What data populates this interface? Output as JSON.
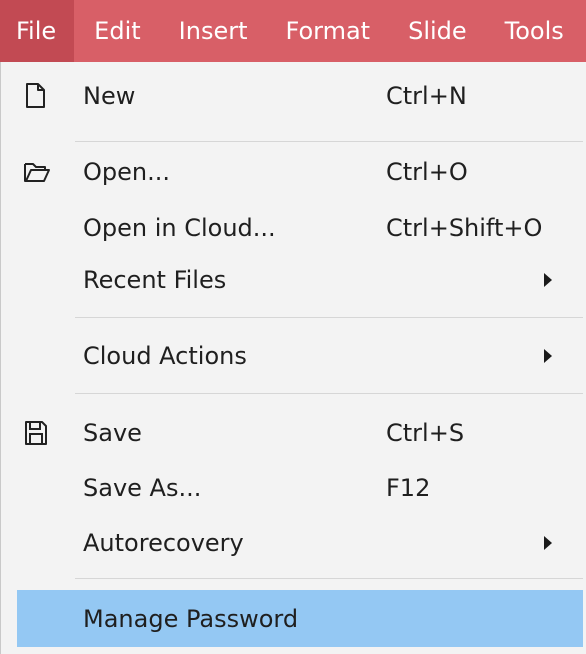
{
  "menubar": {
    "items": [
      {
        "label": "File"
      },
      {
        "label": "Edit"
      },
      {
        "label": "Insert"
      },
      {
        "label": "Format"
      },
      {
        "label": "Slide"
      },
      {
        "label": "Tools"
      }
    ]
  },
  "file_menu": {
    "new": {
      "label": "New",
      "shortcut": "Ctrl+N",
      "icon": "new-document-icon"
    },
    "open": {
      "label": "Open...",
      "shortcut": "Ctrl+O",
      "icon": "folder-open-icon"
    },
    "open_cloud": {
      "label": "Open in Cloud...",
      "shortcut": "Ctrl+Shift+O"
    },
    "recent_files": {
      "label": "Recent Files"
    },
    "cloud_actions": {
      "label": "Cloud Actions"
    },
    "save": {
      "label": "Save",
      "shortcut": "Ctrl+S",
      "icon": "floppy-disk-icon"
    },
    "save_as": {
      "label": "Save As...",
      "shortcut": "F12"
    },
    "autorecovery": {
      "label": "Autorecovery"
    },
    "manage_password": {
      "label": "Manage Password"
    }
  },
  "colors": {
    "menubar_bg": "#d85f67",
    "active_menu_bg": "#c24a53",
    "highlight": "#94c8f3"
  }
}
